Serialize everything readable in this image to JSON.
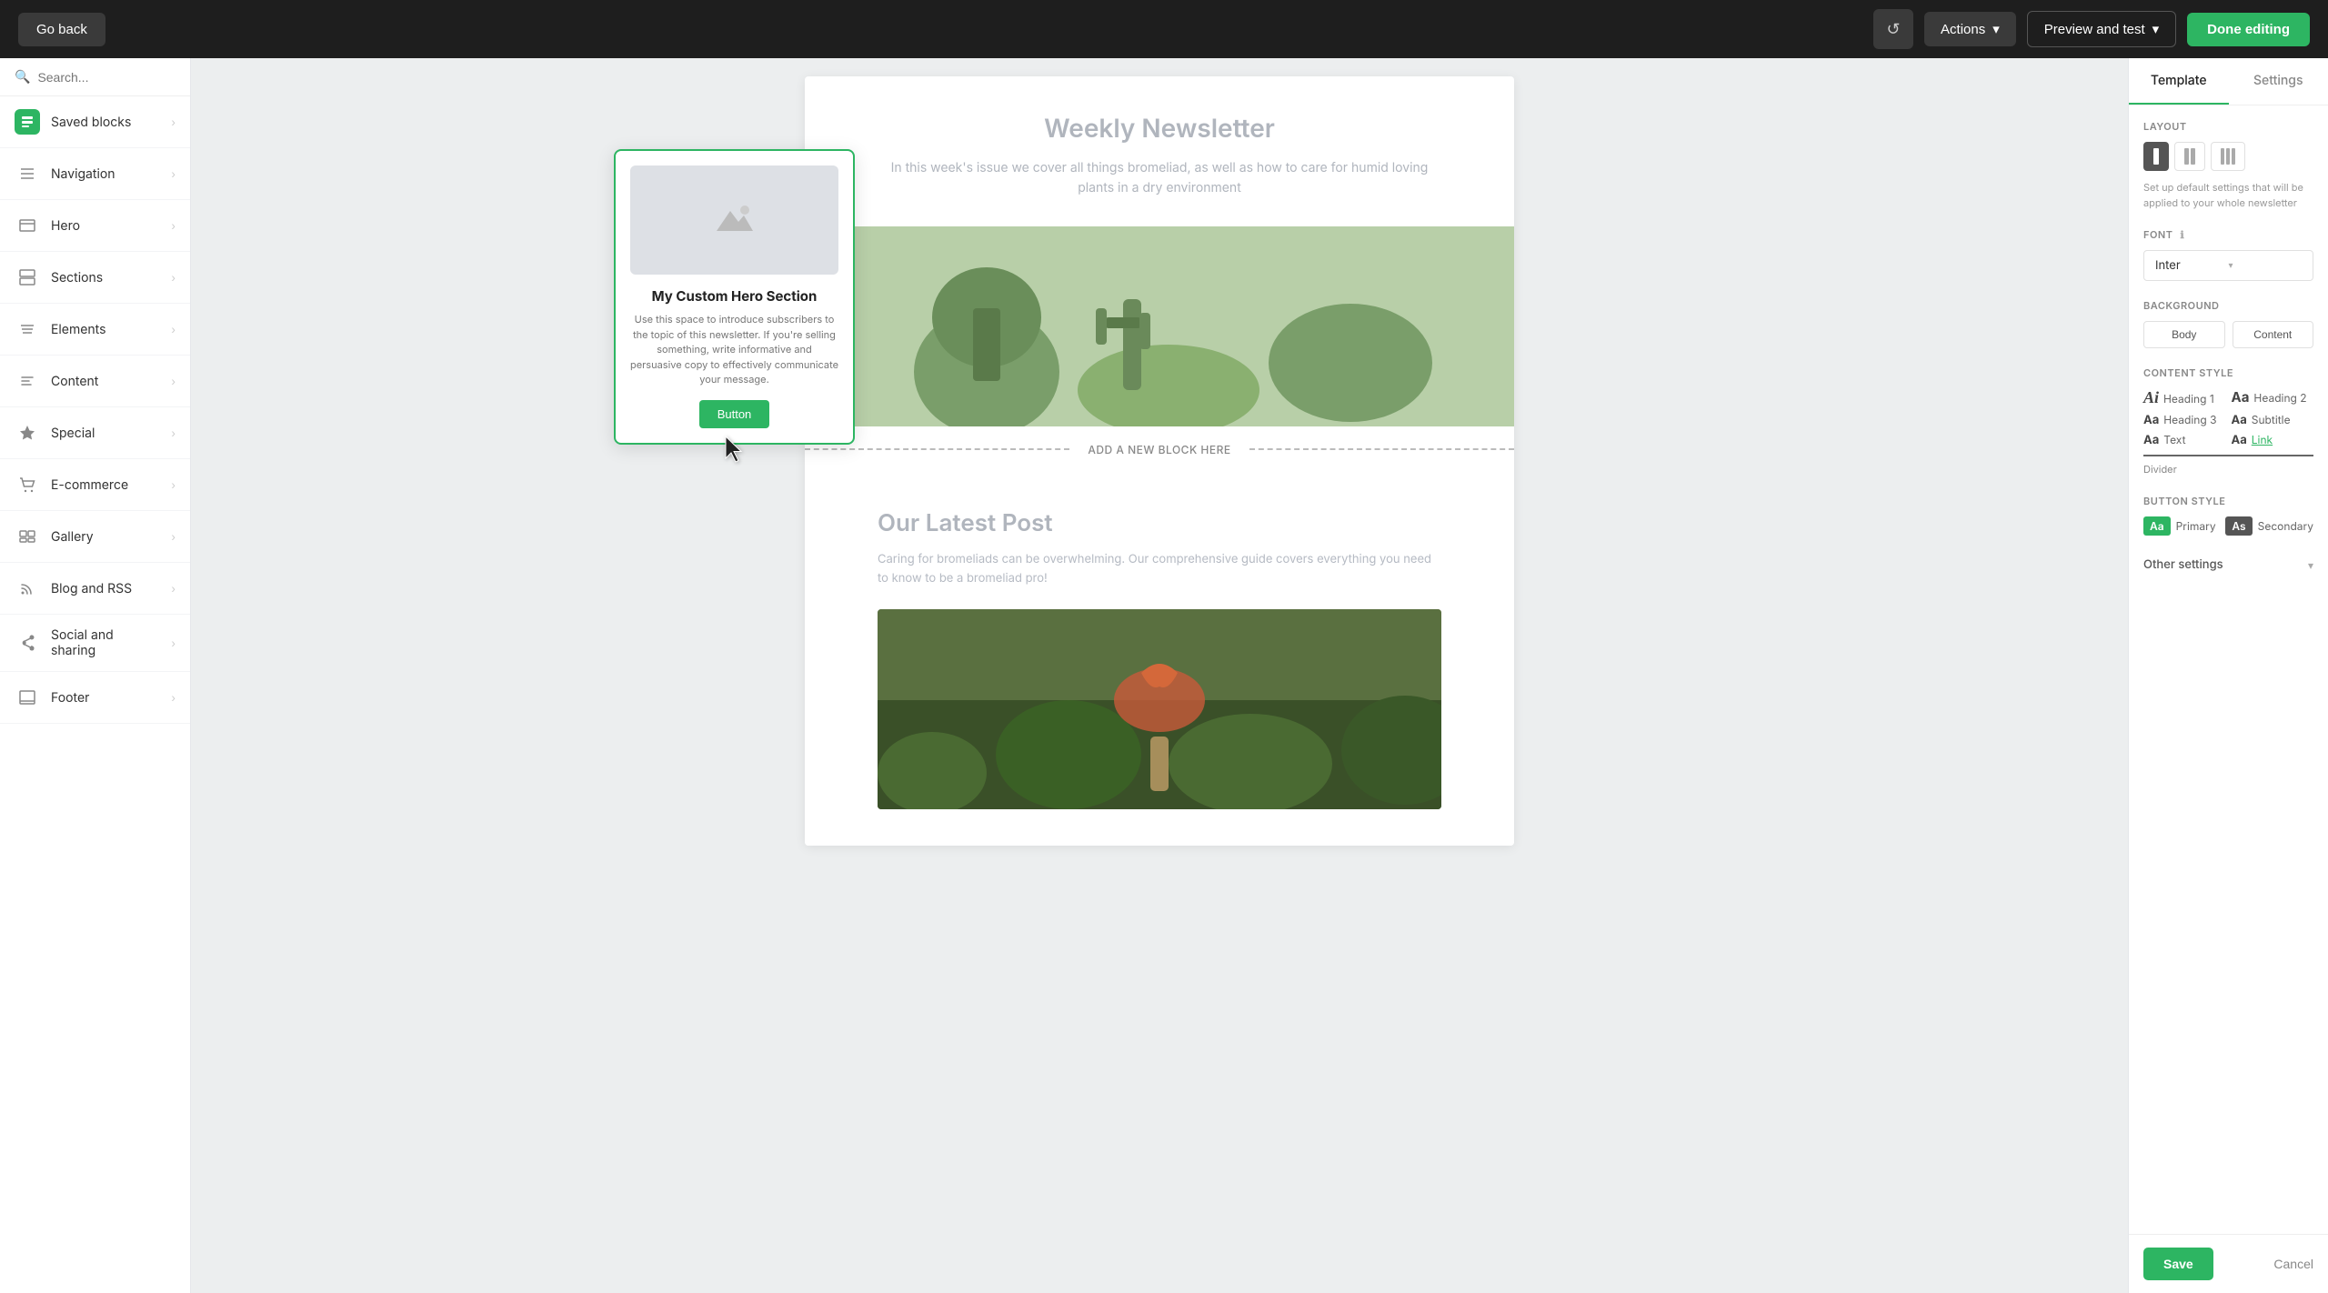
{
  "topbar": {
    "go_back_label": "Go back",
    "actions_label": "Actions",
    "preview_label": "Preview and test",
    "done_label": "Done editing"
  },
  "sidebar": {
    "search_placeholder": "Search...",
    "items": [
      {
        "id": "saved-blocks",
        "label": "Saved blocks",
        "icon": "bookmark",
        "green": true
      },
      {
        "id": "navigation",
        "label": "Navigation",
        "icon": "navigation"
      },
      {
        "id": "hero",
        "label": "Hero",
        "icon": "hero"
      },
      {
        "id": "sections",
        "label": "Sections",
        "icon": "sections"
      },
      {
        "id": "elements",
        "label": "Elements",
        "icon": "elements"
      },
      {
        "id": "content",
        "label": "Content",
        "icon": "content"
      },
      {
        "id": "special",
        "label": "Special",
        "icon": "special"
      },
      {
        "id": "ecommerce",
        "label": "E-commerce",
        "icon": "ecommerce"
      },
      {
        "id": "gallery",
        "label": "Gallery",
        "icon": "gallery"
      },
      {
        "id": "blog-rss",
        "label": "Blog and RSS",
        "icon": "rss"
      },
      {
        "id": "social",
        "label": "Social and sharing",
        "icon": "social"
      },
      {
        "id": "footer",
        "label": "Footer",
        "icon": "footer"
      }
    ]
  },
  "floating_block": {
    "title": "My Custom Hero Section",
    "description": "Use this space to introduce subscribers to the topic of this newsletter. If you're selling something, write informative and persuasive copy to effectively communicate your message.",
    "button_label": "Button"
  },
  "email": {
    "title": "Weekly Newsletter",
    "intro": "In this week's issue we cover all things bromeliad, as well as how to care for humid loving plants in a dry environment",
    "add_block_label": "ADD A NEW BLOCK HERE",
    "blog_title": "Our Latest Post",
    "blog_text": "Caring for bromeliads can be overwhelming. Our comprehensive guide covers everything you need to know to be a bromeliad pro!"
  },
  "right_panel": {
    "tabs": [
      {
        "id": "template",
        "label": "Template"
      },
      {
        "id": "settings",
        "label": "Settings"
      }
    ],
    "active_tab": "template",
    "layout_label": "Layout",
    "layout_description": "Set up default settings that will be applied to your whole newsletter",
    "font_label": "Font",
    "font_info": "ℹ",
    "font_value": "Inter",
    "background_label": "Background",
    "bg_options": [
      "Body",
      "Content"
    ],
    "content_style_label": "Content style",
    "content_styles": [
      {
        "aa": "Ai",
        "label": "Heading 1",
        "size": "large",
        "type": "serif"
      },
      {
        "aa": "Aa",
        "label": "Heading 2",
        "size": "medium",
        "type": "normal"
      },
      {
        "aa": "Aa",
        "label": "Heading 3",
        "size": "small",
        "type": "normal"
      },
      {
        "aa": "Aa",
        "label": "Subtitle",
        "size": "small",
        "type": "normal"
      },
      {
        "aa": "Aa",
        "label": "Text",
        "size": "small",
        "type": "normal"
      },
      {
        "aa": "Aa",
        "label": "Link",
        "size": "small",
        "type": "link"
      }
    ],
    "divider_label": "Divider",
    "button_style_label": "Button style",
    "button_styles": [
      {
        "label": "Primary",
        "type": "primary"
      },
      {
        "label": "Secondary",
        "type": "secondary"
      }
    ],
    "other_settings_label": "Other settings",
    "save_label": "Save",
    "cancel_label": "Cancel"
  }
}
